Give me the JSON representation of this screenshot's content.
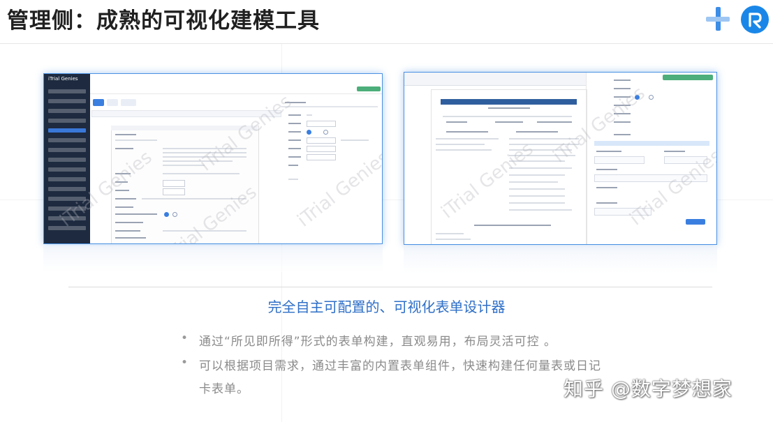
{
  "header": {
    "title": "管理侧：成熟的可视化建模工具"
  },
  "icons": {
    "brand_plus": "plus-icon",
    "brand_logo": "circle-logo-icon",
    "accent": "#1a87e8"
  },
  "screenshots": {
    "left": {
      "brand": "iTrial Genies",
      "watermark": "iTrial Genies"
    },
    "right": {
      "watermark": "iTrial Genies"
    }
  },
  "section": {
    "subtitle": "完全自主可配置的、可视化表单设计器",
    "bullets": [
      {
        "marker": "•",
        "text": "通过“所见即所得”形式的表单构建，直观易用，布局灵活可控 。"
      },
      {
        "marker": "•",
        "text": "可以根据项目需求，通过丰富的内置表单组件，快速构建任何量表或日记"
      }
    ],
    "bullet_cont": "卡表单。"
  },
  "footer": {
    "watermark": "知乎 @数字梦想家"
  }
}
